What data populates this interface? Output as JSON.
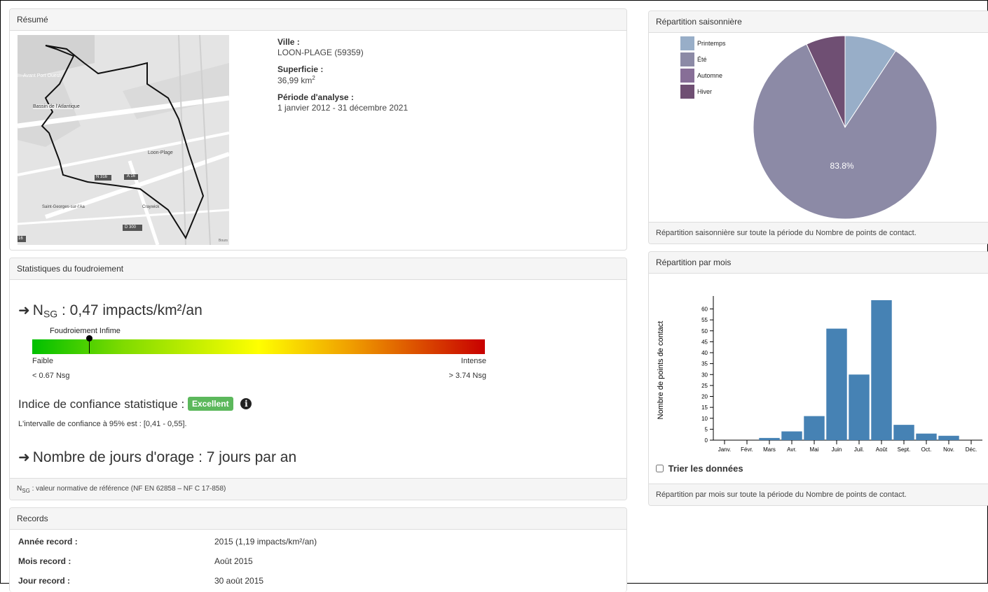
{
  "summary": {
    "title": "Résumé",
    "map_labels": [
      "Avant Port Ouest",
      "Bassin de l'Atlantique",
      "Loon-Plage",
      "N 316",
      "A 16",
      "Saint-Georges-sur-l'Aa",
      "Craywick",
      "D 300",
      "16",
      "Bours"
    ],
    "city_label": "Ville :",
    "city_value": "LOON-PLAGE (59359)",
    "area_label": "Superficie :",
    "area_value": "36,99 km",
    "area_unit_sup": "2",
    "period_label": "Période d'analyse :",
    "period_value": "1 janvier 2012 - 31 décembre 2021"
  },
  "stats": {
    "title": "Statistiques du foudroiement",
    "nsg_symbol": "N",
    "nsg_sub": "SG",
    "nsg_value": " : 0,47 impacts/km²/an",
    "marker_label": "Foudroiement Infime",
    "marker_fraction": 0.125,
    "low_label": "Faible",
    "low_value": "< 0.67 Nsg",
    "high_label": "Intense",
    "high_value": "> 3.74 Nsg",
    "confidence_label": "Indice de confiance statistique :",
    "confidence_badge": "Excellent",
    "interval_text": "L'intervalle de confiance à 95% est : [0,41 - 0,55].",
    "storm_days_text": "Nombre de jours d'orage : 7 jours par an",
    "footer_sub": "SG",
    "footer_text": " : valeur normative de référence (NF EN 62858 – NF C 17-858)"
  },
  "records": {
    "title": "Records",
    "rows": [
      {
        "label": "Année record :",
        "value": "2015 (1,19 impacts/km²/an)"
      },
      {
        "label": "Mois record :",
        "value": "Août 2015"
      },
      {
        "label": "Jour record :",
        "value": "30 août 2015"
      }
    ]
  },
  "seasonal": {
    "title": "Répartition saisonnière",
    "footer": "Répartition saisonnière sur toute la période du Nombre de points de contact."
  },
  "monthly": {
    "title": "Répartition par mois",
    "sort_label": "Trier les données",
    "sort_checked": false,
    "footer": "Répartition par mois sur toute la période du Nombre de points de contact."
  },
  "chart_data": [
    {
      "type": "pie",
      "title": "",
      "legend": [
        "Printemps",
        "Été",
        "Automne",
        "Hiver"
      ],
      "legend_position": "top-left",
      "values": [
        9.3,
        83.8,
        0,
        6.9
      ],
      "slice_labels": [
        "",
        "83.8%",
        "",
        ""
      ],
      "colors": [
        "#98aec8",
        "#8c8aa6",
        "#876e97",
        "#6f4f73"
      ]
    },
    {
      "type": "bar",
      "title": "",
      "ylabel": "Nombre de points de contact",
      "xlabel": "",
      "categories": [
        "Janv.",
        "Févr.",
        "Mars",
        "Avr.",
        "Mai",
        "Juin",
        "Juil.",
        "Août",
        "Sept.",
        "Oct.",
        "Nov.",
        "Déc."
      ],
      "values": [
        0,
        0,
        1,
        4,
        11,
        51,
        30,
        64,
        7,
        3,
        2,
        0
      ],
      "ylim": [
        0,
        64
      ],
      "yticks": [
        0,
        5,
        10,
        15,
        20,
        25,
        30,
        35,
        40,
        45,
        50,
        55,
        60
      ],
      "grid": false,
      "color": "#4682b4"
    }
  ]
}
